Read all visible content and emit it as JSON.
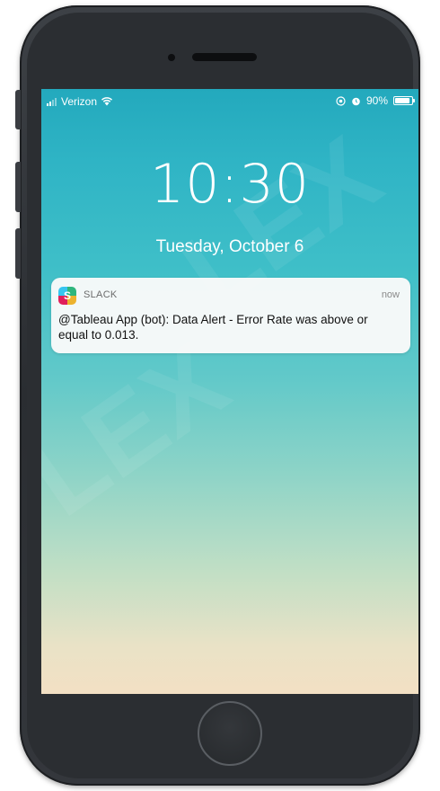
{
  "status_bar": {
    "carrier": "Verizon",
    "battery_percent": "90%",
    "battery_level": 0.9,
    "icons": [
      "signal-icon",
      "wifi-icon",
      "location-icon",
      "alarm-icon",
      "battery-icon"
    ]
  },
  "lock_screen": {
    "time": "10:30",
    "date": "Tuesday, October 6"
  },
  "notification": {
    "app_name": "SLACK",
    "time": "now",
    "message": "@Tableau App (bot): Data Alert - Error Rate was above or equal to 0.013.",
    "app_icon_glyph": "S"
  },
  "colors": {
    "wallpaper_top": "#23a9bd",
    "wallpaper_bottom": "#f3e0c4",
    "phone_body": "#2b2e32"
  }
}
